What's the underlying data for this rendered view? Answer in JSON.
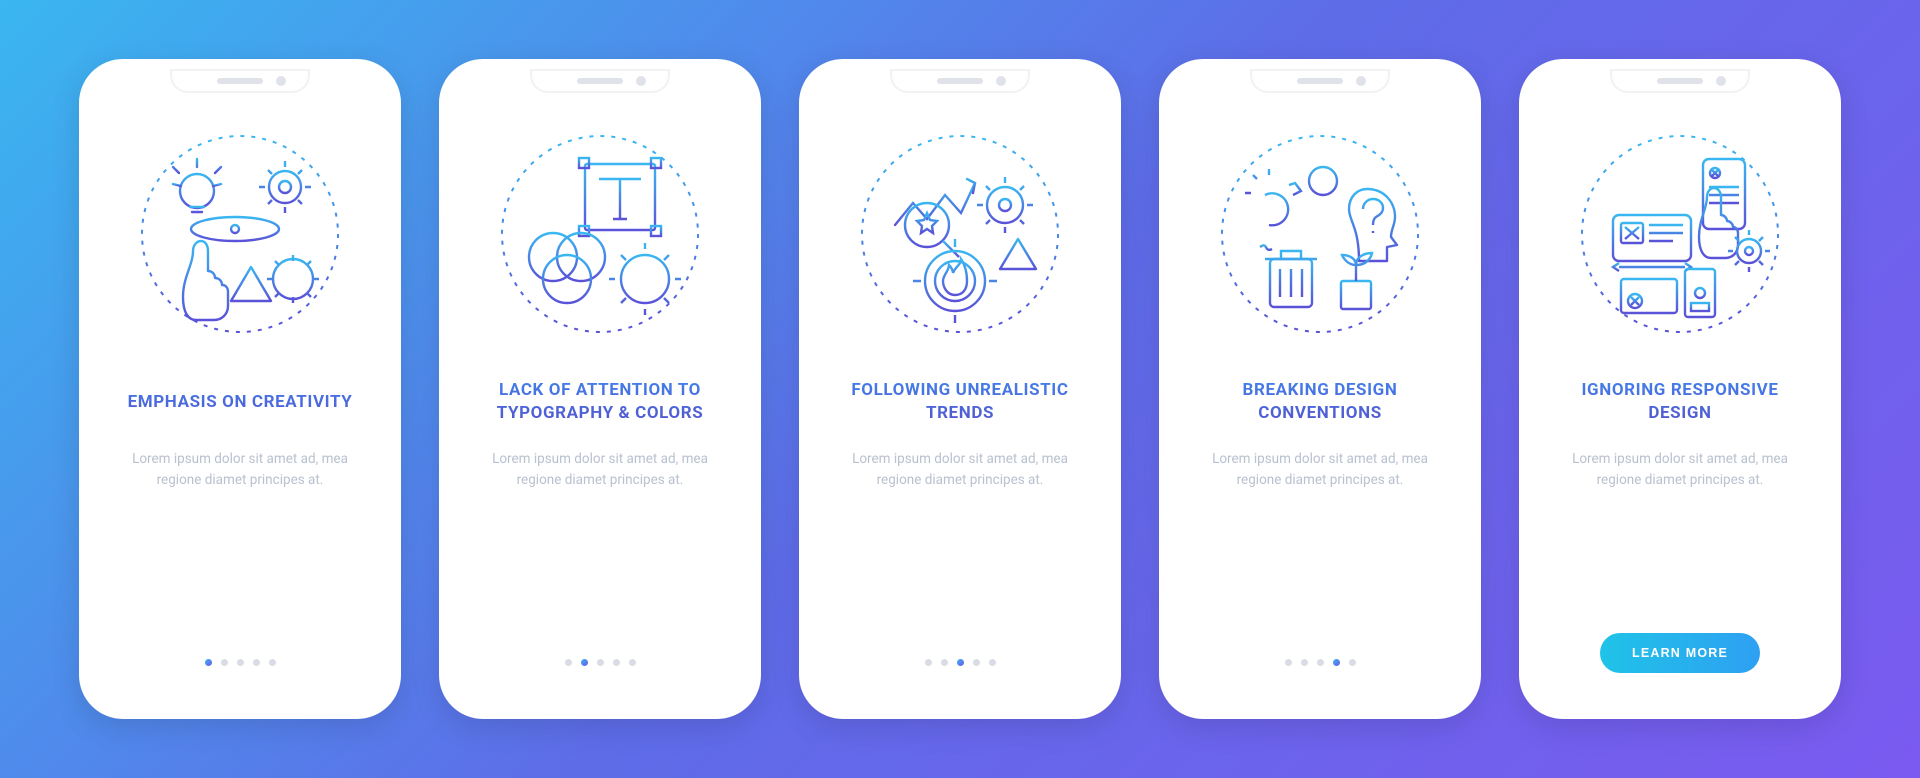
{
  "colors": {
    "grad_start": "#3AB6F0",
    "grad_mid": "#5E6CE8",
    "grad_end": "#7A5AF0",
    "title_top": "#3E8CF3",
    "title_bottom": "#5848C6",
    "body_text": "#b9c0cf",
    "cta_start": "#1FC3E8",
    "cta_end": "#2EA0F2"
  },
  "body_text": "Lorem ipsum dolor sit amet ad, mea regione diamet principes at.",
  "cta_label": "LEARN MORE",
  "slides": [
    {
      "title": "EMPHASIS ON CREATIVITY",
      "illustration": "creativity-icon"
    },
    {
      "title": "LACK OF ATTENTION TO TYPOGRAPHY & COLORS",
      "illustration": "typography-icon"
    },
    {
      "title": "FOLLOWING UNREALISTIC TRENDS",
      "illustration": "trends-icon"
    },
    {
      "title": "BREAKING DESIGN CONVENTIONS",
      "illustration": "conventions-icon"
    },
    {
      "title": "IGNORING RESPONSIVE DESIGN",
      "illustration": "responsive-icon"
    }
  ],
  "total_slides": 5
}
